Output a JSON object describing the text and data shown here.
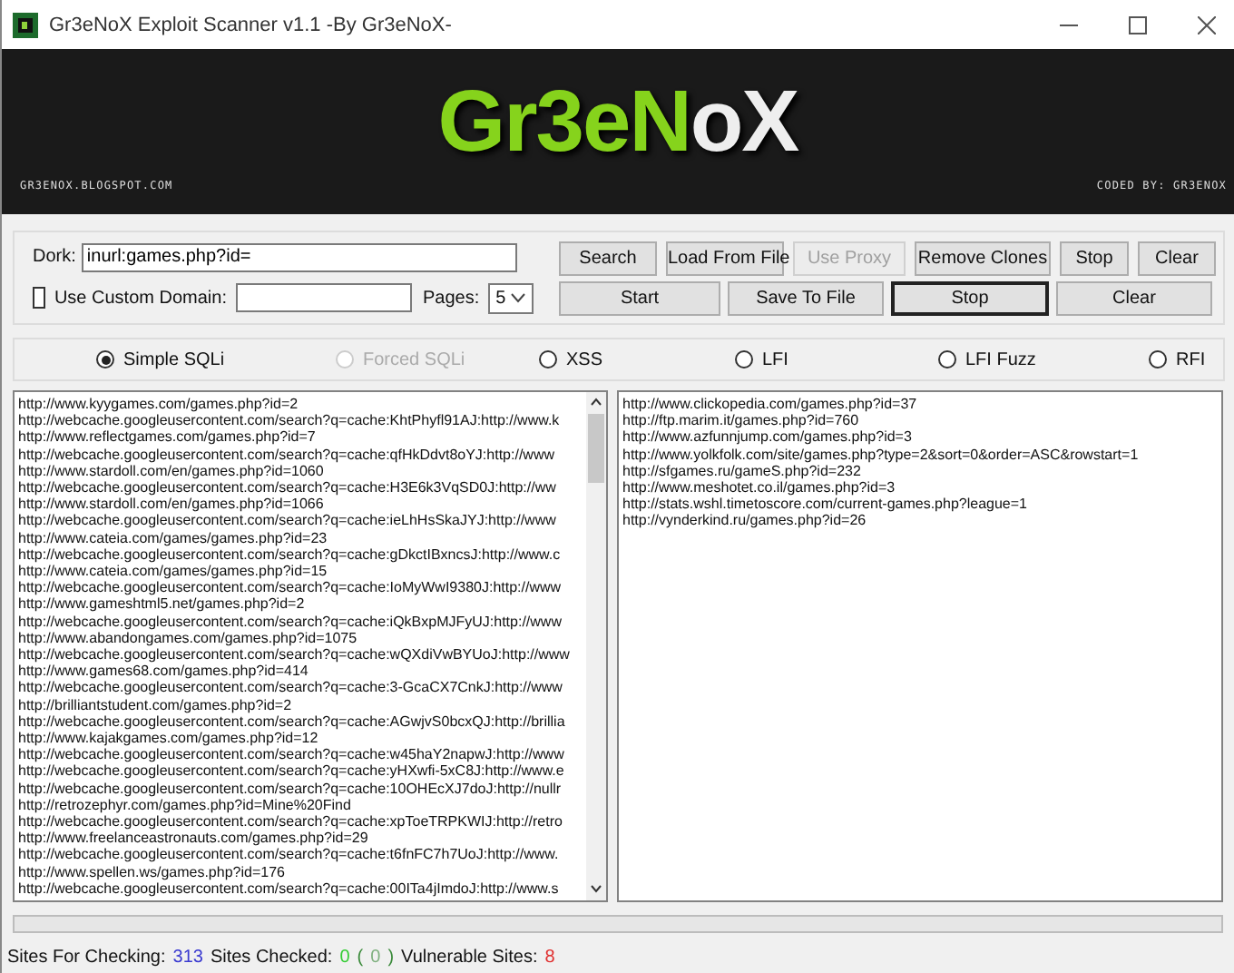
{
  "window": {
    "title": "Gr3eNoX Exploit Scanner v1.1 -By Gr3eNoX-"
  },
  "banner": {
    "logo": [
      {
        "text": "Gr3eN",
        "color": "#86d31c"
      },
      {
        "text": "oX",
        "color": "#eeeeee"
      }
    ],
    "site": "GR3ENOX.BLOGSPOT.COM",
    "credit": "CODED BY: GR3ENOX"
  },
  "search_panel": {
    "dork_label": "Dork:",
    "dork_value": "inurl:games.php?id=",
    "custom_domain": {
      "label": "Use Custom Domain:",
      "checked": false
    },
    "pages_label": "Pages:",
    "pages_value": "5",
    "buttons_row_1": [
      {
        "label": "Search",
        "disabled": false,
        "default": false
      },
      {
        "label": "Load From File",
        "disabled": false,
        "default": false
      },
      {
        "label": "Use Proxy",
        "disabled": true,
        "default": false
      },
      {
        "label": "Remove Clones",
        "disabled": false,
        "default": false
      },
      {
        "label": "Stop",
        "disabled": false,
        "default": false
      },
      {
        "label": "Clear",
        "disabled": false,
        "default": false
      }
    ],
    "buttons_row_2": [
      {
        "label": "Start",
        "disabled": false,
        "default": false
      },
      {
        "label": "Save To File",
        "disabled": false,
        "default": false
      },
      {
        "label": "Stop",
        "disabled": false,
        "default": true
      },
      {
        "label": "Clear",
        "disabled": false,
        "default": false
      }
    ]
  },
  "scan_types": [
    {
      "label": "Simple SQLi",
      "selected": true,
      "disabled": false
    },
    {
      "label": "Forced SQLi",
      "selected": false,
      "disabled": true
    },
    {
      "label": "XSS",
      "selected": false,
      "disabled": false
    },
    {
      "label": "LFI",
      "selected": false,
      "disabled": false
    },
    {
      "label": "LFI Fuzz",
      "selected": false,
      "disabled": false
    },
    {
      "label": "RFI",
      "selected": false,
      "disabled": false
    }
  ],
  "sites_list": [
    "http://www.kyygames.com/games.php?id=2",
    "http://webcache.googleusercontent.com/search?q=cache:KhtPhyfl91AJ:http://www.k",
    "http://www.reflectgames.com/games.php?id=7",
    "http://webcache.googleusercontent.com/search?q=cache:qfHkDdvt8oYJ:http://www",
    "http://www.stardoll.com/en/games.php?id=1060",
    "http://webcache.googleusercontent.com/search?q=cache:H3E6k3VqSD0J:http://ww",
    "http://www.stardoll.com/en/games.php?id=1066",
    "http://webcache.googleusercontent.com/search?q=cache:ieLhHsSkaJYJ:http://www",
    "http://www.cateia.com/games/games.php?id=23",
    "http://webcache.googleusercontent.com/search?q=cache:gDkctIBxncsJ:http://www.c",
    "http://www.cateia.com/games/games.php?id=15",
    "http://webcache.googleusercontent.com/search?q=cache:IoMyWwI9380J:http://www",
    "http://www.gameshtml5.net/games.php?id=2",
    "http://webcache.googleusercontent.com/search?q=cache:iQkBxpMJFyUJ:http://www",
    "http://www.abandongames.com/games.php?id=1075",
    "http://webcache.googleusercontent.com/search?q=cache:wQXdiVwBYUoJ:http://www",
    "http://www.games68.com/games.php?id=414",
    "http://webcache.googleusercontent.com/search?q=cache:3-GcaCX7CnkJ:http://www",
    "http://brilliantstudent.com/games.php?id=2",
    "http://webcache.googleusercontent.com/search?q=cache:AGwjvS0bcxQJ:http://brillia",
    "http://www.kajakgames.com/games.php?id=12",
    "http://webcache.googleusercontent.com/search?q=cache:w45haY2napwJ:http://www",
    "http://webcache.googleusercontent.com/search?q=cache:yHXwfi-5xC8J:http://www.e",
    "http://webcache.googleusercontent.com/search?q=cache:10OHEcXJ7doJ:http://nullr",
    "http://retrozephyr.com/games.php?id=Mine%20Find",
    "http://webcache.googleusercontent.com/search?q=cache:xpToeTRPKWIJ:http://retro",
    "http://www.freelanceastronauts.com/games.php?id=29",
    "http://webcache.googleusercontent.com/search?q=cache:t6fnFC7h7UoJ:http://www.",
    "http://www.spellen.ws/games.php?id=176",
    "http://webcache.googleusercontent.com/search?q=cache:00ITa4jImdoJ:http://www.s"
  ],
  "vulnerable_list": [
    "http://www.clickopedia.com/games.php?id=37",
    "http://ftp.marim.it/games.php?id=760",
    "http://www.azfunnjump.com/games.php?id=3",
    "http://www.yolkfolk.com/site/games.php?type=2&sort=0&order=ASC&rowstart=1",
    "http://sfgames.ru/gameS.php?id=232",
    "http://www.meshotet.co.il/games.php?id=3",
    "http://stats.wshl.timetoscore.com/current-games.php?league=1",
    "http://vynderkind.ru/games.php?id=26"
  ],
  "status_bar": [
    {
      "text": "Sites For Checking:"
    },
    {
      "text": "313",
      "color": "#3a3ad0"
    },
    {
      "text": "Sites Checked:"
    },
    {
      "text": "0",
      "color": "#33cc33"
    },
    {
      "text": "(",
      "color": "#3a8a3a"
    },
    {
      "text": "0",
      "color": "#7fb07f"
    },
    {
      "text": ")",
      "color": "#3a8a3a"
    },
    {
      "text": "Vulnerable Sites:"
    },
    {
      "text": "8",
      "color": "#e03030"
    }
  ]
}
